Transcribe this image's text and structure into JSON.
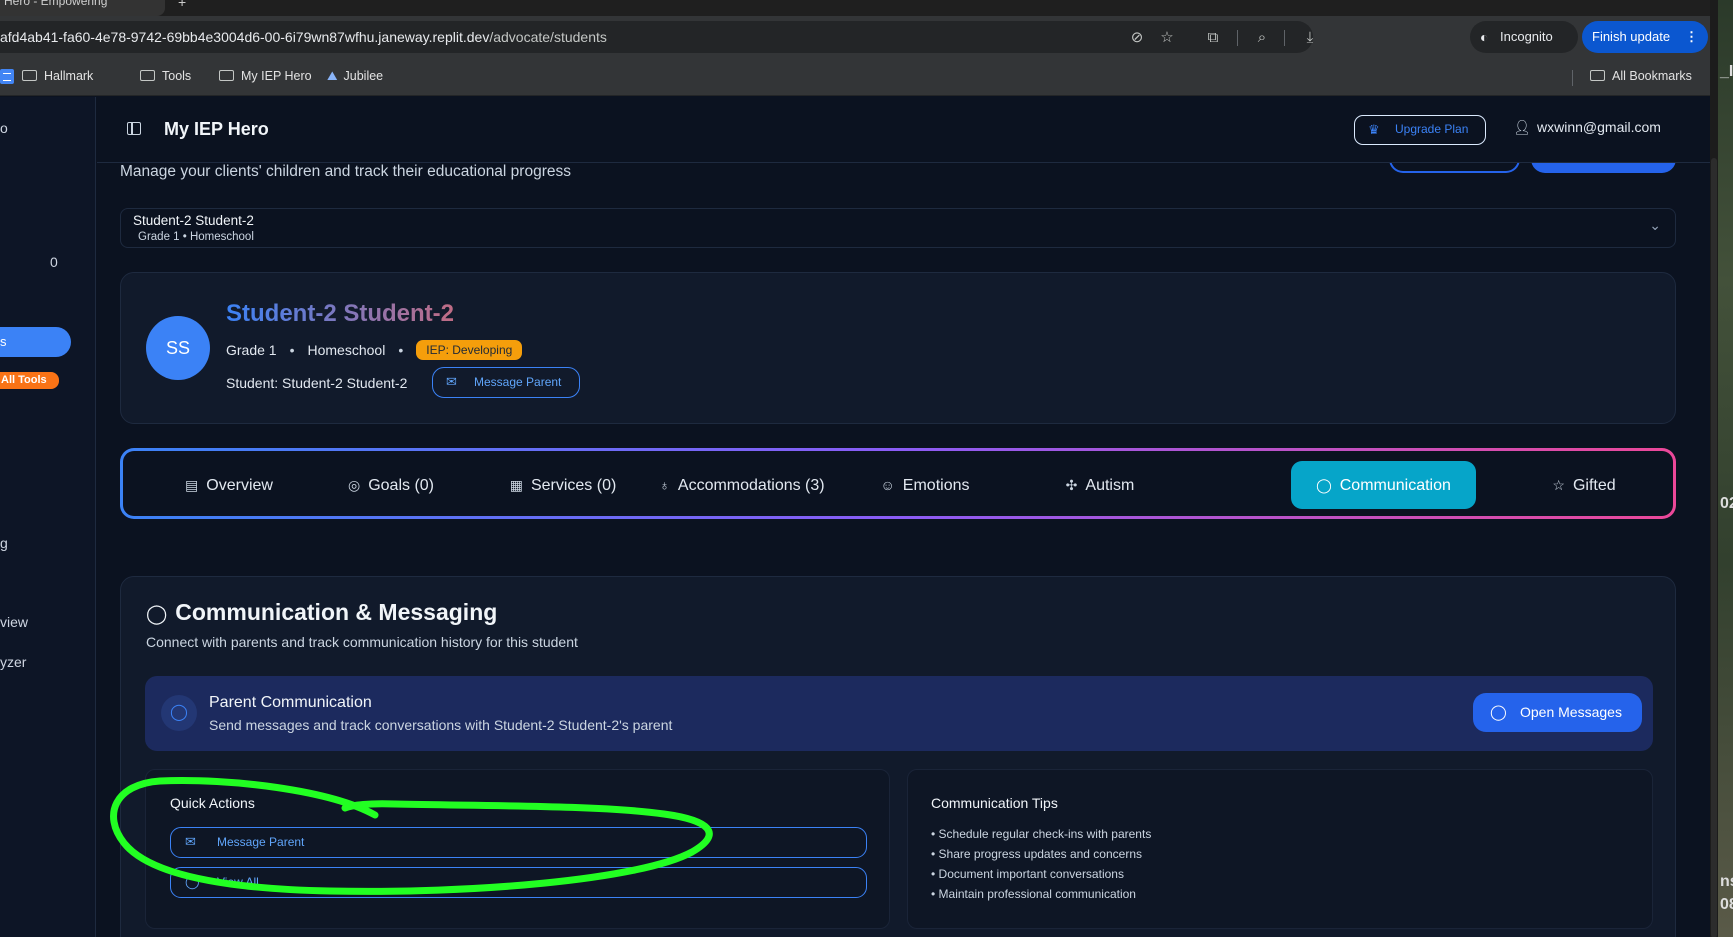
{
  "browser": {
    "tab_title": "Hero - Empowering",
    "url_host": "afd4ab41-fa60-4e78-9742-69bb4e3004d6-00-6i79wn87wfhu.janeway.replit.dev",
    "url_path": "/advocate/students",
    "incognito_label": "Incognito",
    "finish_update_label": "Finish update",
    "bookmarks": [
      "Hallmark",
      "Tools",
      "My IEP Hero",
      "Jubilee"
    ],
    "all_bookmarks_label": "All Bookmarks"
  },
  "desktop_fragments": [
    "_IE",
    "02",
    "nsh",
    "08."
  ],
  "sidebar": {
    "fragments": [
      "o",
      "0",
      "s",
      "All Tools",
      "g",
      "view",
      "yzer"
    ]
  },
  "header": {
    "app_title": "My IEP Hero",
    "upgrade_label": "Upgrade Plan",
    "user_email": "wxwinn@gmail.com"
  },
  "page": {
    "subtitle": "Manage your clients' children and track their educational progress"
  },
  "student_selector": {
    "name": "Student-2 Student-2",
    "sub": "Grade 1 • Homeschool"
  },
  "profile": {
    "initials": "SS",
    "name": "Student-2 Student-2",
    "grade": "Grade 1",
    "school": "Homeschool",
    "iep_badge": "IEP: Developing",
    "student_line": "Student: Student-2 Student-2",
    "message_parent_label": "Message Parent"
  },
  "tabs": [
    {
      "label": "Overview",
      "icon": "document-icon"
    },
    {
      "label": "Goals  (0)",
      "icon": "target-icon"
    },
    {
      "label": "Services  (0)",
      "icon": "building-icon"
    },
    {
      "label": "Accommodations  (3)",
      "icon": "lightbulb-icon"
    },
    {
      "label": "Emotions",
      "icon": "smile-icon"
    },
    {
      "label": "Autism",
      "icon": "puzzle-icon"
    },
    {
      "label": "Communication",
      "icon": "chat-icon",
      "active": true
    },
    {
      "label": "Gifted",
      "icon": "star-icon"
    }
  ],
  "communication": {
    "title": "Communication & Messaging",
    "description": "Connect with parents and track communication history for this student",
    "parent_box": {
      "title": "Parent Communication",
      "subtitle": "Send messages and track conversations with Student-2 Student-2's parent",
      "open_messages_label": "Open Messages"
    },
    "quick_actions": {
      "title": "Quick Actions",
      "buttons": [
        "Message Parent",
        "View All"
      ]
    },
    "tips": {
      "title": "Communication Tips",
      "items": [
        "• Schedule regular check-ins with parents",
        "• Share progress updates and concerns",
        "• Document important conversations",
        "• Maintain professional communication"
      ]
    }
  },
  "colors": {
    "accent": "#3b82f6",
    "active_tab": "#06a5c9",
    "badge": "#f59e0b",
    "annotation": "#22ff22"
  }
}
